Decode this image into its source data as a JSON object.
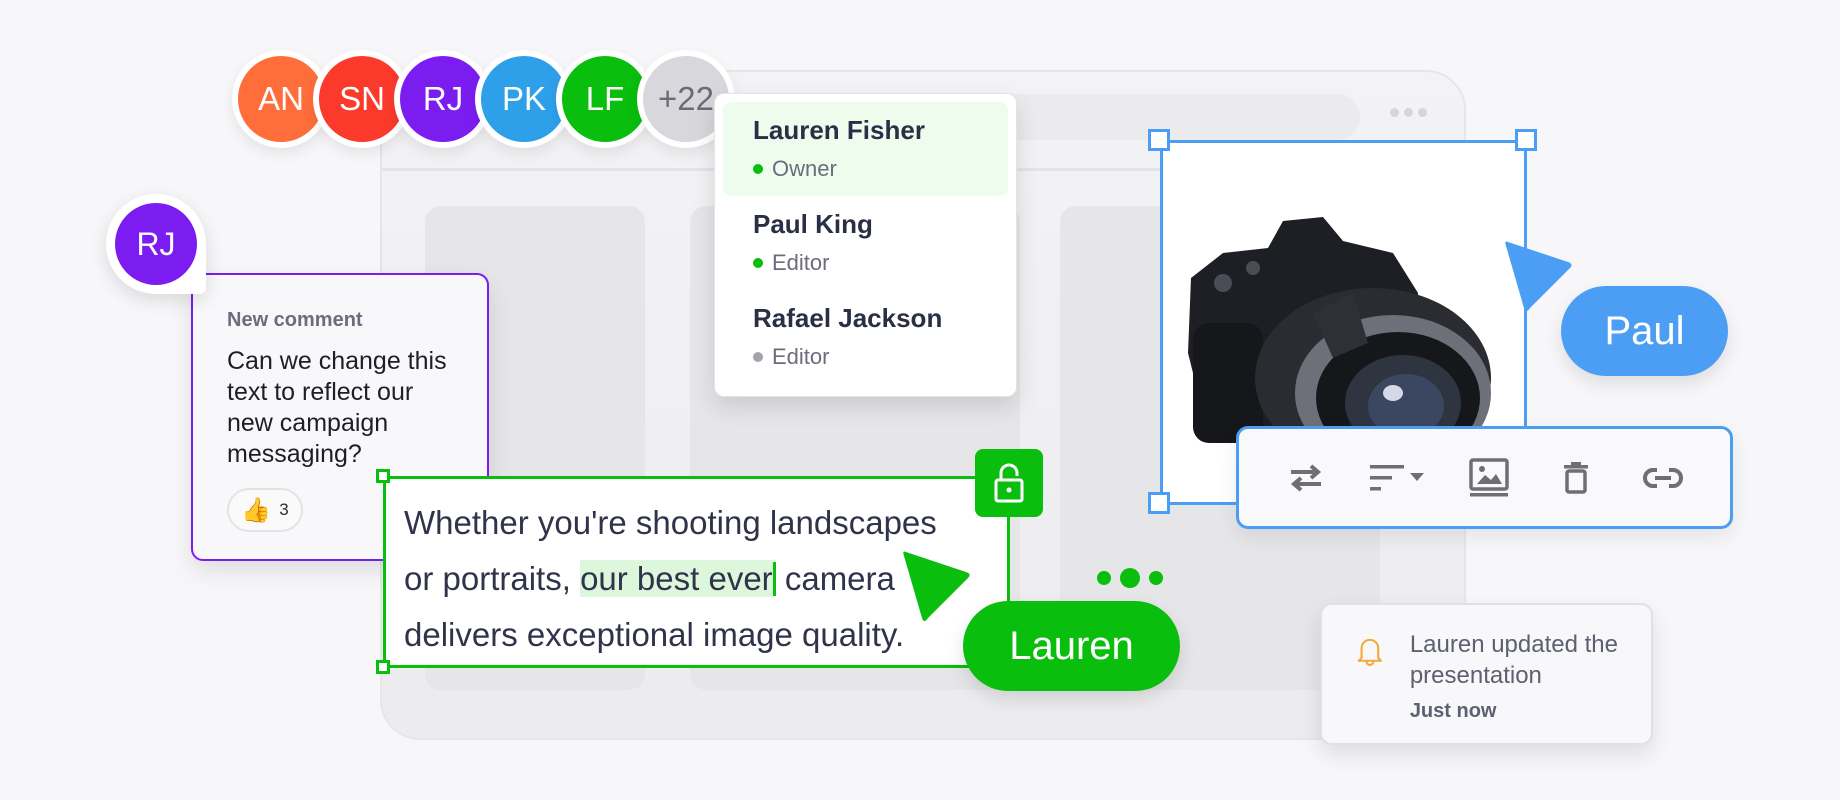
{
  "avatars": [
    {
      "initials": "AN",
      "color": "#ff6e3a"
    },
    {
      "initials": "SN",
      "color": "#fb3a2c"
    },
    {
      "initials": "RJ",
      "color": "#7b1df0"
    },
    {
      "initials": "PK",
      "color": "#2ea0ea"
    },
    {
      "initials": "LF",
      "color": "#09be0c"
    }
  ],
  "avatar_overflow": "+22",
  "members": [
    {
      "name": "Lauren Fisher",
      "role": "Owner",
      "status_color": "#09be0c",
      "active": true
    },
    {
      "name": "Paul King",
      "role": "Editor",
      "status_color": "#09be0c",
      "active": false
    },
    {
      "name": "Rafael Jackson",
      "role": "Editor",
      "status_color": "#a3a3ab",
      "active": false
    }
  ],
  "comment": {
    "author_initials": "RJ",
    "title": "New comment",
    "body": "Can we change this text to reflect our new campaign messaging?",
    "reaction_icon": "thumbs-up-icon",
    "reaction_count": "3"
  },
  "textbox": {
    "line1": "Whether you're shooting landscapes",
    "line2_before": "or portraits, ",
    "line2_highlight": "our best ever",
    "line2_after": " camera",
    "line3": "delivers exceptional image quality."
  },
  "cursors": {
    "lauren": {
      "label": "Lauren",
      "color": "#09be0c"
    },
    "paul": {
      "label": "Paul",
      "color": "#4b9ef4"
    }
  },
  "image_toolbar": {
    "buttons": [
      {
        "name": "swap-icon",
        "label": "Replace image"
      },
      {
        "name": "align-icon",
        "label": "Alignment"
      },
      {
        "name": "image-icon",
        "label": "Image settings"
      },
      {
        "name": "trash-icon",
        "label": "Delete"
      },
      {
        "name": "link-icon",
        "label": "Link"
      }
    ]
  },
  "notification": {
    "icon": "bell-icon",
    "message": "Lauren updated the presentation",
    "time": "Just now"
  },
  "colors": {
    "green": "#09be0c",
    "blue": "#4b9ef4",
    "purple": "#7b1df0",
    "bell": "#f2a93b"
  }
}
